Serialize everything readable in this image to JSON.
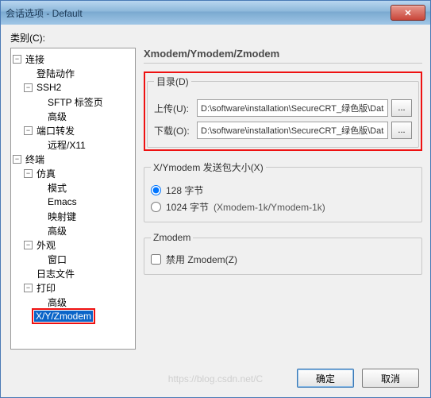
{
  "window": {
    "title": "会话选项 - Default"
  },
  "sidebar": {
    "label": "类别(C):",
    "tree": {
      "connection": {
        "label": "连接",
        "toggle": "−"
      },
      "login": {
        "label": "登陆动作"
      },
      "ssh2": {
        "label": "SSH2",
        "toggle": "−"
      },
      "sftp": {
        "label": "SFTP 标签页"
      },
      "advanced_ssh": {
        "label": "高级"
      },
      "portfwd": {
        "label": "端口转发",
        "toggle": "−"
      },
      "remote_x11": {
        "label": "远程/X11"
      },
      "terminal": {
        "label": "终端",
        "toggle": "−"
      },
      "emulation": {
        "label": "仿真",
        "toggle": "−"
      },
      "mode": {
        "label": "模式"
      },
      "emacs": {
        "label": "Emacs"
      },
      "mapkey": {
        "label": "映射键"
      },
      "advanced_emu": {
        "label": "高级"
      },
      "appearance": {
        "label": "外观",
        "toggle": "−"
      },
      "window": {
        "label": "窗口"
      },
      "logfile": {
        "label": "日志文件"
      },
      "print": {
        "label": "打印",
        "toggle": "−"
      },
      "advanced_print": {
        "label": "高级"
      },
      "xyz": {
        "label": "X/Y/Zmodem"
      }
    }
  },
  "panel": {
    "title": "Xmodem/Ymodem/Zmodem",
    "dir_legend": "目录(D)",
    "upload_label": "上传(U):",
    "download_label": "下载(O):",
    "upload_value": "D:\\software\\installation\\SecureCRT_绿色版\\Data\\",
    "download_value": "D:\\software\\installation\\SecureCRT_绿色版\\Data\\",
    "browse_label": "...",
    "packet_legend": "X/Ymodem 发送包大小(X)",
    "opt128": "128 字节",
    "opt1024": "1024 字节",
    "opt1024_suffix": "(Xmodem-1k/Ymodem-1k)",
    "zmodem_legend": "Zmodem",
    "disable_zmodem": "禁用 Zmodem(Z)"
  },
  "buttons": {
    "ok": "确定",
    "cancel": "取消"
  },
  "watermark": "https://blog.csdn.net/C"
}
